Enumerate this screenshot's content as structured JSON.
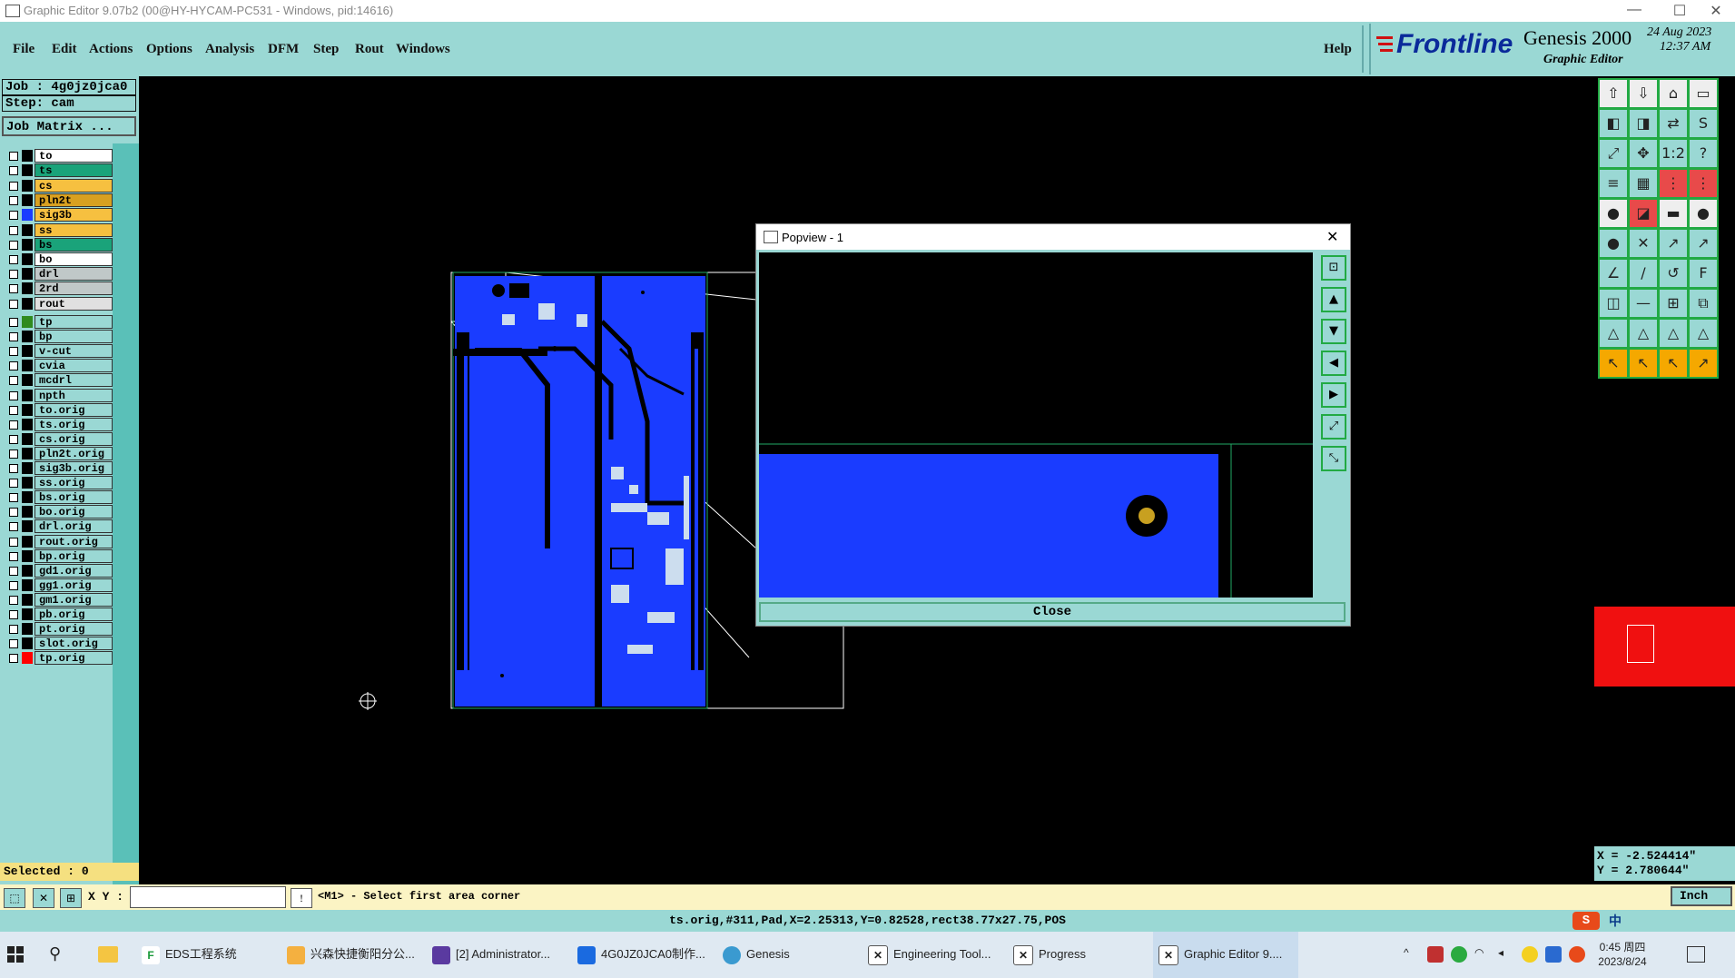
{
  "window": {
    "title": "Graphic Editor 9.07b2 (00@HY-HYCAM-PC531 - Windows, pid:14616)",
    "minimize": "—",
    "maximize": "☐",
    "close": "✕"
  },
  "menu": [
    "File",
    "Edit",
    "Actions",
    "Options",
    "Analysis",
    "DFM",
    "Step",
    "Rout",
    "Windows"
  ],
  "help_label": "Help",
  "logo": {
    "brand": "Frontline",
    "product": "Genesis 2000",
    "subtitle": "Graphic Editor",
    "date": "24 Aug 2023",
    "time": "12:37 AM"
  },
  "job": {
    "job": "Job : 4g0jz0jca0",
    "step": "Step: cam",
    "matrix_button": "Job Matrix ..."
  },
  "layers_group1": [
    {
      "name": "to",
      "color": "#ffffff",
      "swatch": "#000000"
    },
    {
      "name": "ts",
      "color": "#1aa37a",
      "swatch": "#000000"
    },
    {
      "name": "cs",
      "color": "#f6c040",
      "swatch": "#000000"
    },
    {
      "name": "pln2t",
      "color": "#d8a020",
      "swatch": "#000000"
    },
    {
      "name": "sig3b",
      "color": "#f6c040",
      "swatch": "#1a3cff"
    },
    {
      "name": "ss",
      "color": "#f6c040",
      "swatch": "#000000"
    },
    {
      "name": "bs",
      "color": "#1aa37a",
      "swatch": "#000000"
    },
    {
      "name": "bo",
      "color": "#ffffff",
      "swatch": "#000000"
    }
  ],
  "layers_group2": [
    {
      "name": "drl",
      "color": "#c0c8c8",
      "swatch": "#000000"
    },
    {
      "name": "2rd",
      "color": "#c0c8c8",
      "swatch": "#000000"
    },
    {
      "name": "rout",
      "color": "#e0e0e0",
      "swatch": "#000000"
    }
  ],
  "layers_group3": [
    {
      "name": "tp",
      "color": "#9ad8d4",
      "swatch": "#2f8a1e"
    },
    {
      "name": "bp",
      "color": "#9ad8d4",
      "swatch": "#000000"
    },
    {
      "name": "v-cut",
      "color": "#9ad8d4",
      "swatch": "#000000"
    },
    {
      "name": "cvia",
      "color": "#9ad8d4",
      "swatch": "#000000"
    },
    {
      "name": "mcdrl",
      "color": "#9ad8d4",
      "swatch": "#000000"
    },
    {
      "name": "npth",
      "color": "#9ad8d4",
      "swatch": "#000000"
    },
    {
      "name": "to.orig",
      "color": "#9ad8d4",
      "swatch": "#000000"
    },
    {
      "name": "ts.orig",
      "color": "#9ad8d4",
      "swatch": "#000000"
    },
    {
      "name": "cs.orig",
      "color": "#9ad8d4",
      "swatch": "#000000"
    },
    {
      "name": "pln2t.orig",
      "color": "#9ad8d4",
      "swatch": "#000000"
    },
    {
      "name": "sig3b.orig",
      "color": "#9ad8d4",
      "swatch": "#000000"
    },
    {
      "name": "ss.orig",
      "color": "#9ad8d4",
      "swatch": "#000000"
    },
    {
      "name": "bs.orig",
      "color": "#9ad8d4",
      "swatch": "#000000"
    },
    {
      "name": "bo.orig",
      "color": "#9ad8d4",
      "swatch": "#000000"
    },
    {
      "name": "drl.orig",
      "color": "#9ad8d4",
      "swatch": "#000000"
    },
    {
      "name": "rout.orig",
      "color": "#9ad8d4",
      "swatch": "#000000"
    },
    {
      "name": "bp.orig",
      "color": "#9ad8d4",
      "swatch": "#000000"
    },
    {
      "name": "gd1.orig",
      "color": "#9ad8d4",
      "swatch": "#000000"
    },
    {
      "name": "gg1.orig",
      "color": "#9ad8d4",
      "swatch": "#000000"
    },
    {
      "name": "gm1.orig",
      "color": "#9ad8d4",
      "swatch": "#000000"
    },
    {
      "name": "pb.orig",
      "color": "#9ad8d4",
      "swatch": "#000000"
    },
    {
      "name": "pt.orig",
      "color": "#9ad8d4",
      "swatch": "#000000"
    },
    {
      "name": "slot.orig",
      "color": "#9ad8d4",
      "swatch": "#000000"
    },
    {
      "name": "tp.orig",
      "color": "#9ad8d4",
      "swatch": "#ff0000"
    }
  ],
  "selected": "Selected : 0",
  "popview": {
    "title": "Popview - 1",
    "close_label": "Close",
    "close_x": "✕"
  },
  "coords": {
    "x": "X = -2.524414\"",
    "y": "Y = 2.780644\""
  },
  "command": {
    "xy_label": "X Y :",
    "prompt": "<M1> - Select first area corner",
    "units": "Inch"
  },
  "status_text": "ts.orig,#311,Pad,X=2.25313,Y=0.82528,rect38.77x27.75,POS",
  "taskbar": {
    "apps": [
      "EDS工程系统",
      "兴森快捷衡阳分公...",
      "[2] Administrator...",
      "4G0JZ0JCA0制作...",
      "Genesis",
      "Engineering Tool...",
      "Progress",
      "Graphic Editor 9...."
    ],
    "time": "0:45 周四",
    "date": "2023/8/24",
    "ime": "中"
  },
  "colors": {
    "accent": "#9ad8d4",
    "pcb_blue": "#1a3cff",
    "pad_gold": "#c8a020"
  }
}
